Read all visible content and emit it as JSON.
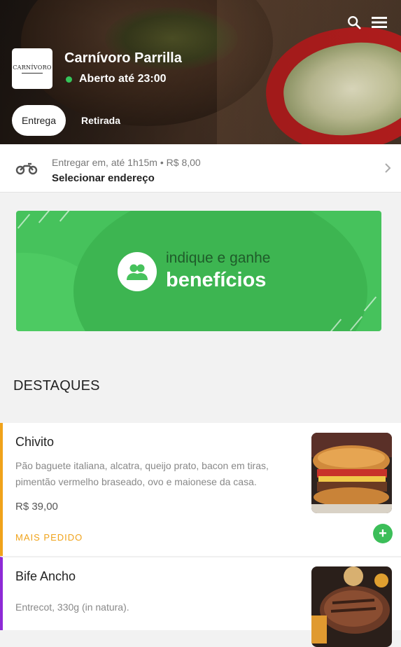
{
  "header": {
    "store_name": "Carnívoro Parrilla",
    "status": "Aberto até 23:00",
    "status_color": "#35c55a",
    "logo_text": "CARNÍVORO",
    "tabs": [
      {
        "label": "Entrega",
        "selected": true
      },
      {
        "label": "Retirada",
        "selected": false
      }
    ],
    "icons": [
      "search-icon",
      "menu-icon"
    ]
  },
  "delivery": {
    "info": "Entregar em, até 1h15m • R$ 8,00",
    "action": "Selecionar endereço",
    "icon": "motorcycle-icon"
  },
  "banner": {
    "small_text": "indique e ganhe",
    "big_text": "benefícios",
    "icon": "users-icon",
    "color": "#46c25c"
  },
  "section": {
    "title": "DESTAQUES"
  },
  "products": [
    {
      "name": "Chivito",
      "description": "Pão baguete italiana, alcatra, queijo prato, bacon em tiras, pimentão vermelho braseado, ovo e maionese da casa.",
      "price": "R$ 39,00",
      "badge": "MAIS PEDIDO",
      "accent": "#f0a31b"
    },
    {
      "name": "Bife Ancho",
      "description": "Entrecot, 330g (in natura).",
      "accent": "#8e2ad6"
    }
  ]
}
